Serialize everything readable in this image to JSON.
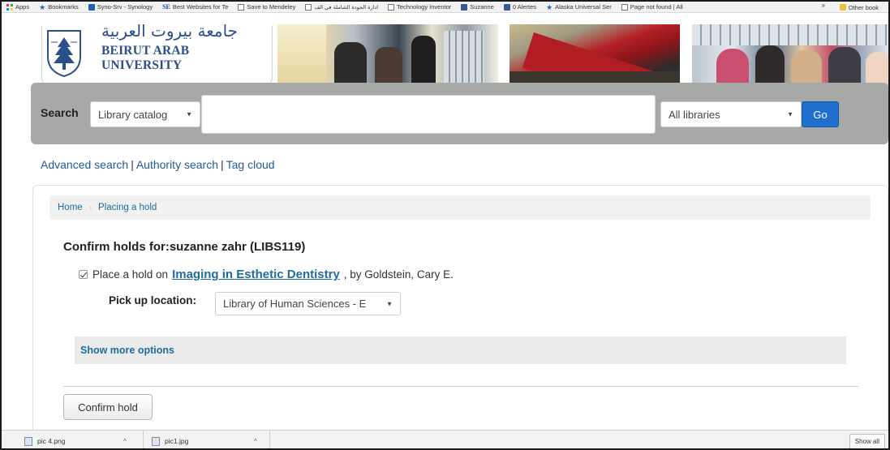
{
  "bookmarks": {
    "items": [
      {
        "label": "Apps",
        "icon": "apps-icon"
      },
      {
        "label": "Bookmarks",
        "icon": "star-icon"
      },
      {
        "label": "Syno-Srv - Synology",
        "icon": "synology-icon"
      },
      {
        "label": "Best Websites for Te",
        "icon": "se-icon"
      },
      {
        "label": "Save to Mendeley",
        "icon": "page-icon"
      },
      {
        "label": "ادارة الجودة الشاملة في الف",
        "icon": "page-icon"
      },
      {
        "label": "Technology Inventor",
        "icon": "page-icon"
      },
      {
        "label": "Suzanne",
        "icon": "facebook-icon"
      },
      {
        "label": "0 Alertes",
        "icon": "facebook-icon"
      },
      {
        "label": "Alaska Universal Ser",
        "icon": "star-icon"
      },
      {
        "label": "Page not found | All",
        "icon": "page-icon"
      }
    ],
    "overflow": "»",
    "other": "Other book"
  },
  "header": {
    "university_arabic": "جامعة بيروت العربية",
    "university_english": "BEIRUT ARAB UNIVERSITY"
  },
  "search": {
    "label": "Search",
    "catalog_select": "Library catalog",
    "query": "",
    "libraries_select": "All libraries",
    "go_label": "Go"
  },
  "links": {
    "advanced": "Advanced search",
    "authority": "Authority search",
    "tag_cloud": "Tag cloud",
    "separator": "|"
  },
  "breadcrumb": {
    "home": "Home",
    "current": "Placing a hold",
    "separator": "›"
  },
  "hold": {
    "heading": "Confirm holds for:suzanne zahr (LIBS119)",
    "checked": true,
    "prefix": "Place a hold on",
    "title": "Imaging in Esthetic Dentistry",
    "author": ", by Goldstein, Cary E.",
    "pickup_label": "Pick up location:",
    "pickup_value": "Library of Human Sciences - E",
    "more_options": "Show more options",
    "confirm_label": "Confirm hold"
  },
  "downloads": {
    "items": [
      {
        "name": "pic 4.png"
      },
      {
        "name": "pic1.jpg"
      }
    ],
    "show_all": "Show all"
  },
  "colors": {
    "link": "#1f6c9f",
    "search_bar": "#a7a9a6",
    "go_button": "#1f6fcf",
    "logo_blue": "#2a4f8a"
  }
}
